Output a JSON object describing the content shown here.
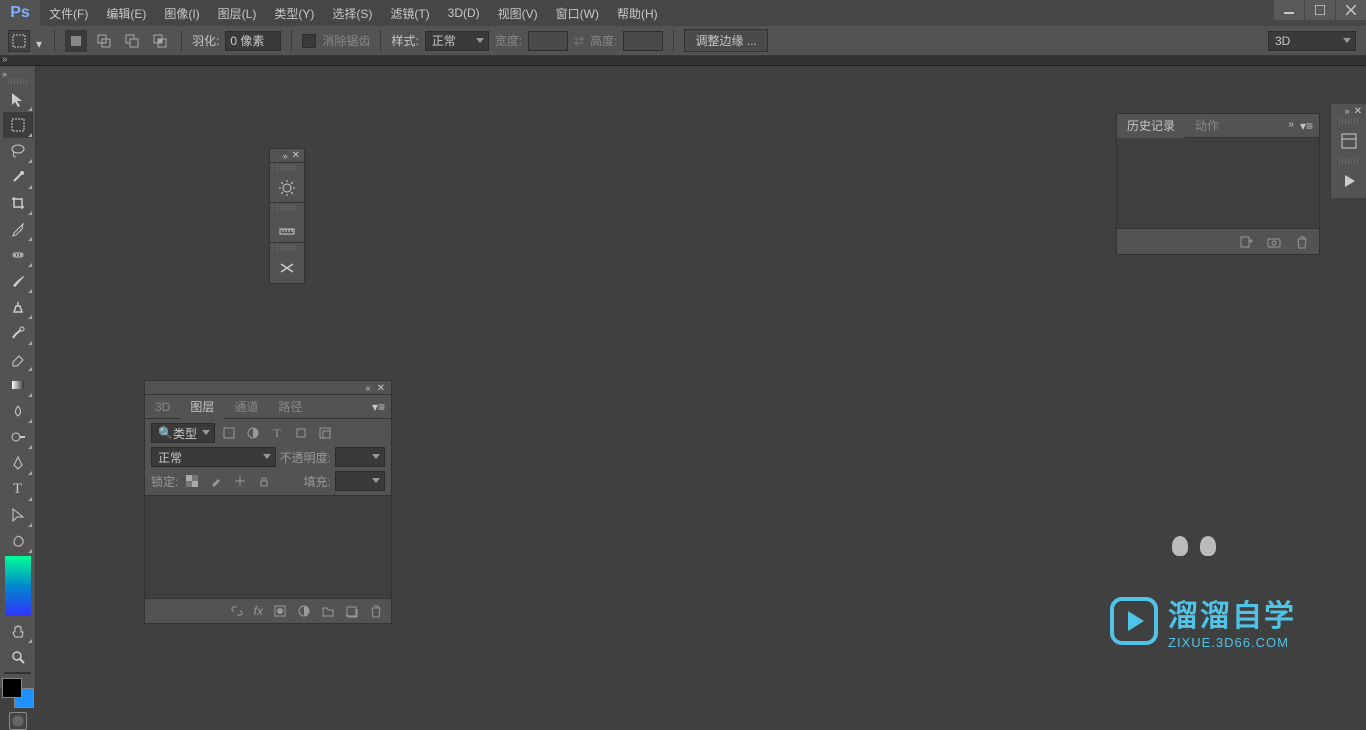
{
  "menubar": {
    "logo": "Ps",
    "items": [
      "文件(F)",
      "编辑(E)",
      "图像(I)",
      "图层(L)",
      "类型(Y)",
      "选择(S)",
      "滤镜(T)",
      "3D(D)",
      "视图(V)",
      "窗口(W)",
      "帮助(H)"
    ]
  },
  "optionsbar": {
    "feather_label": "羽化:",
    "feather_value": "0 像素",
    "antialias": "消除锯齿",
    "style_label": "样式:",
    "style_value": "正常",
    "width_label": "宽度:",
    "height_label": "高度:",
    "refine_edge": "调整边缘 ...",
    "three_d": "3D"
  },
  "history_panel": {
    "tabs": [
      "历史记录",
      "动作"
    ],
    "active_tab": 0
  },
  "layers_panel": {
    "tabs": [
      "3D",
      "图层",
      "通道",
      "路径"
    ],
    "active_tab": 1,
    "kind_label": "类型",
    "blend_mode": "正常",
    "opacity_label": "不透明度:",
    "lock_label": "锁定:",
    "fill_label": "填充:"
  },
  "watermark": {
    "cn": "溜溜自学",
    "en": "ZIXUE.3D66.COM"
  }
}
